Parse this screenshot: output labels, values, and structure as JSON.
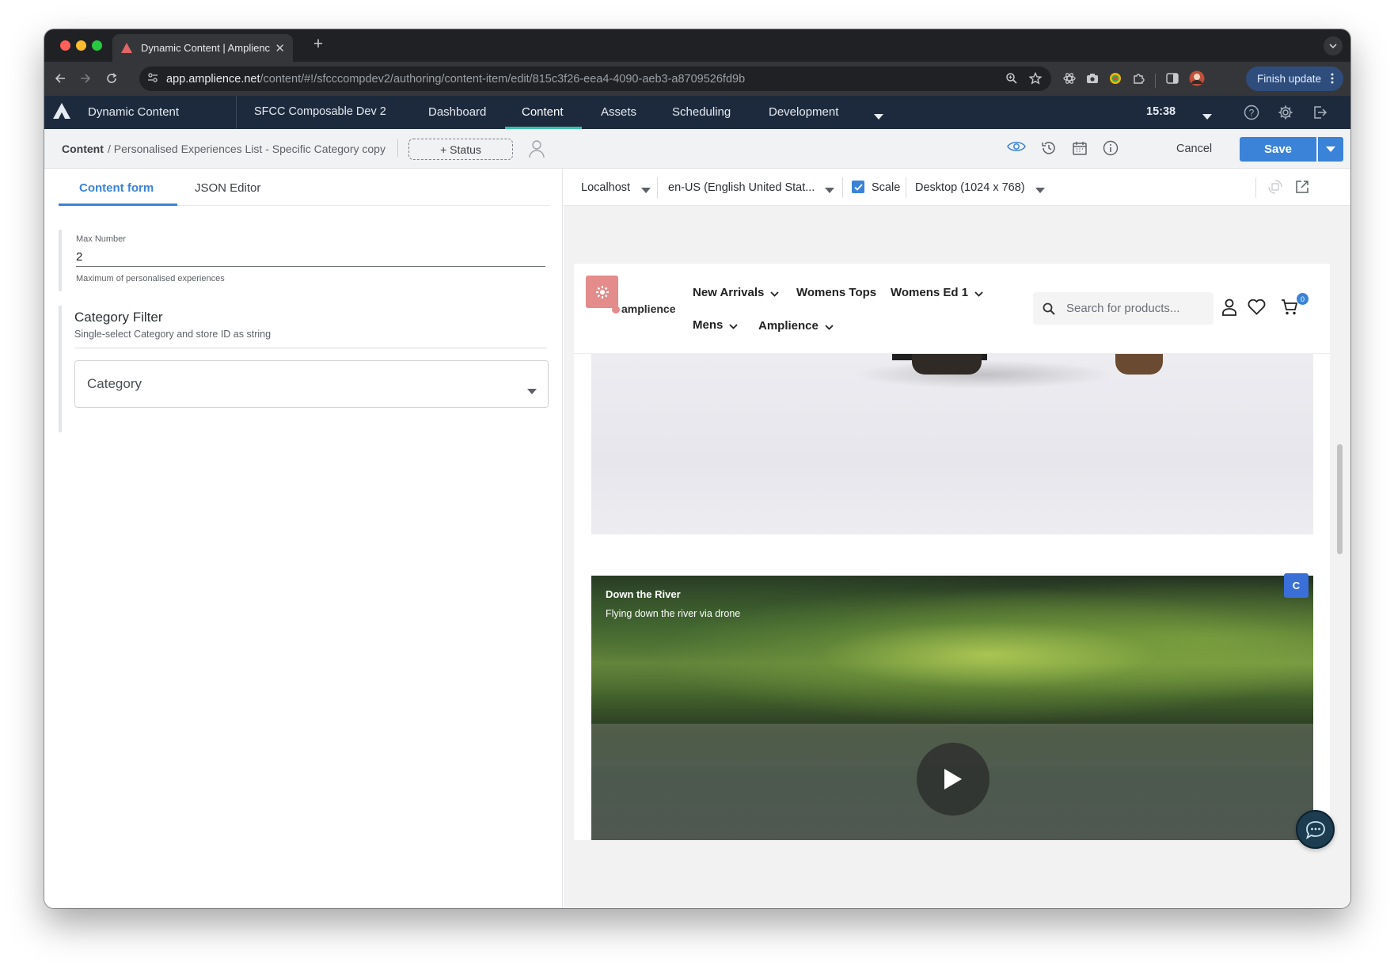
{
  "browser": {
    "tab_title": "Dynamic Content | Amplience",
    "url_host": "app.amplience.net",
    "url_path": "/content/#!/sfcccompdev2/authoring/content-item/edit/815c3f26-eea4-4090-aeb3-a8709526fd9b",
    "finish_update_label": "Finish update"
  },
  "appnav": {
    "brand": "Dynamic Content",
    "hub": "SFCC Composable Dev 2",
    "items": [
      {
        "label": "Dashboard"
      },
      {
        "label": "Content",
        "active": true
      },
      {
        "label": "Assets"
      },
      {
        "label": "Scheduling"
      },
      {
        "label": "Development"
      }
    ],
    "time": "15:38"
  },
  "subbar": {
    "breadcrumb_root": "Content",
    "breadcrumb_path": "/ Personalised Experiences List - Specific Category copy",
    "status_label": "+ Status",
    "cancel_label": "Cancel",
    "save_label": "Save"
  },
  "form": {
    "tabs": [
      "Content form",
      "JSON Editor"
    ],
    "active_tab": "Content form",
    "max_number": {
      "label": "Max Number",
      "value": "2",
      "help": "Maximum of personalised experiences"
    },
    "category_filter": {
      "title": "Category Filter",
      "description": "Single-select Category and store ID as string",
      "placeholder": "Category"
    }
  },
  "preview": {
    "environment": "Localhost",
    "locale": "en-US (English United Stat...",
    "scale_label": "Scale",
    "scale_checked": true,
    "device": "Desktop (1024 x 768)",
    "site": {
      "logo_text": "amplience",
      "menu": [
        "New Arrivals",
        "Womens Tops",
        "Womens Ed 1",
        "Mens",
        "Amplience"
      ],
      "search_placeholder": "Search for products...",
      "cart_count": "0"
    },
    "video": {
      "title": "Down the River",
      "subtitle": "Flying down the river via drone",
      "badge": "C"
    }
  },
  "colors": {
    "accent": "#3a83d8",
    "nav_bg": "#1d2a3d",
    "nav_active_underline": "#3ec0a9"
  }
}
